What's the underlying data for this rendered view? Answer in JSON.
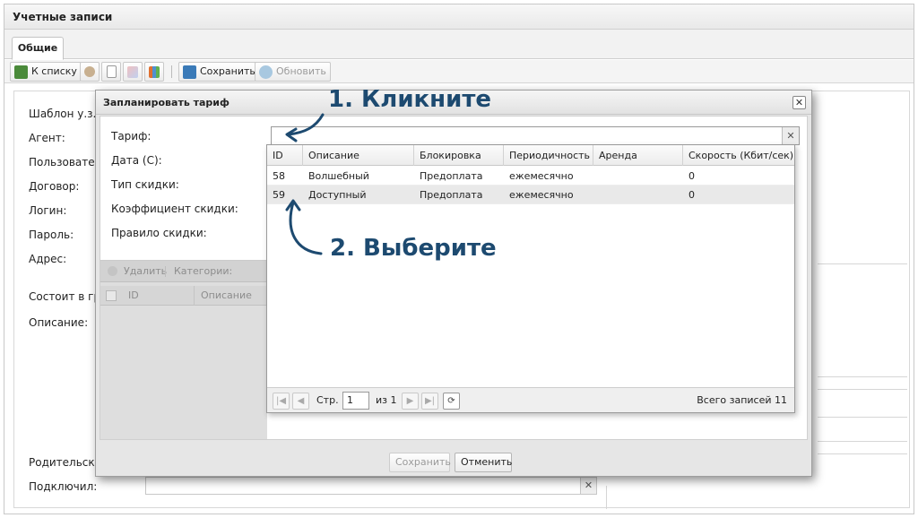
{
  "window": {
    "title": "Учетные записи"
  },
  "tabs": [
    {
      "label": "Общие"
    }
  ],
  "toolbar": {
    "back_label": "К списку",
    "save_label": "Сохранить",
    "refresh_label": "Обновить"
  },
  "form": {
    "labels": {
      "template": "Шаблон у.з.:",
      "agent": "Агент:",
      "user": "Пользовател",
      "contract": "Договор:",
      "login": "Логин:",
      "password": "Пароль:",
      "address": "Адрес:",
      "groups": "Состоит в гру",
      "description": "Описание:",
      "parent": "Родительская",
      "connected": "Подключил:"
    },
    "clear_glyph": "✕"
  },
  "modal": {
    "title": "Запланировать тариф",
    "close_glyph": "✕",
    "labels": {
      "tariff": "Тариф:",
      "date": "Дата (С):",
      "discount_type": "Тип скидки:",
      "discount_coef": "Коэффициент скидки:",
      "discount_rule": "Правило скидки:"
    },
    "tariff_value": "",
    "tariff_clear": "✕",
    "inner_toolbar": {
      "delete_label": "Удалить",
      "categories_label": "Категории:"
    },
    "inner_headers": {
      "id": "ID",
      "description": "Описание"
    },
    "save_label": "Сохранить",
    "cancel_label": "Отменить"
  },
  "dropdown": {
    "columns": [
      "ID",
      "Описание",
      "Блокировка",
      "Периодичность",
      "Аренда",
      "Скорость (Кбит/сек)"
    ],
    "rows": [
      {
        "id": "58",
        "description": "Волшебный",
        "lock": "Предоплата",
        "period": "ежемесячно",
        "rent": "",
        "speed": "0"
      },
      {
        "id": "59",
        "description": "Доступный",
        "lock": "Предоплата",
        "period": "ежемесячно",
        "rent": "",
        "speed": "0"
      }
    ],
    "pager": {
      "page_label": "Стр.",
      "page_value": "1",
      "of_label": "из 1",
      "total_label": "Всего записей 11"
    }
  },
  "annotations": {
    "step1": "1. Кликните",
    "step2": "2. Выберите",
    "color": "#1d4a70"
  }
}
